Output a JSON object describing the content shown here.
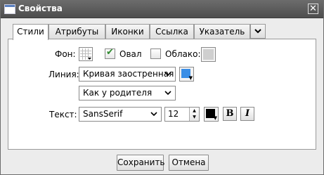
{
  "window": {
    "title": "Свойства",
    "close_glyph": "✕"
  },
  "tabs": [
    {
      "label": "Стили",
      "active": true
    },
    {
      "label": "Атрибуты",
      "active": false
    },
    {
      "label": "Иконки",
      "active": false
    },
    {
      "label": "Ссылка",
      "active": false
    },
    {
      "label": "Указатель",
      "active": false
    }
  ],
  "tabs_more_icon": "chevron-down-icon",
  "styles": {
    "fill_label": "Фон:",
    "oval_label": "Овал",
    "oval_checked": true,
    "cloud_label": "Облако:",
    "cloud_checked": false,
    "line_label": "Линия:",
    "line_type_value": "Кривая заостренная",
    "line_color": "#3a8ee6",
    "line_width_value": "Как у родителя",
    "text_label": "Текст:",
    "font_value": "SansSerif",
    "size_value": "12",
    "text_color": "#000000",
    "bold_label": "B",
    "italic_label": "I",
    "cloud_color": "#cfcfcf"
  },
  "footer": {
    "save_label": "Сохранить",
    "cancel_label": "Отмена"
  }
}
